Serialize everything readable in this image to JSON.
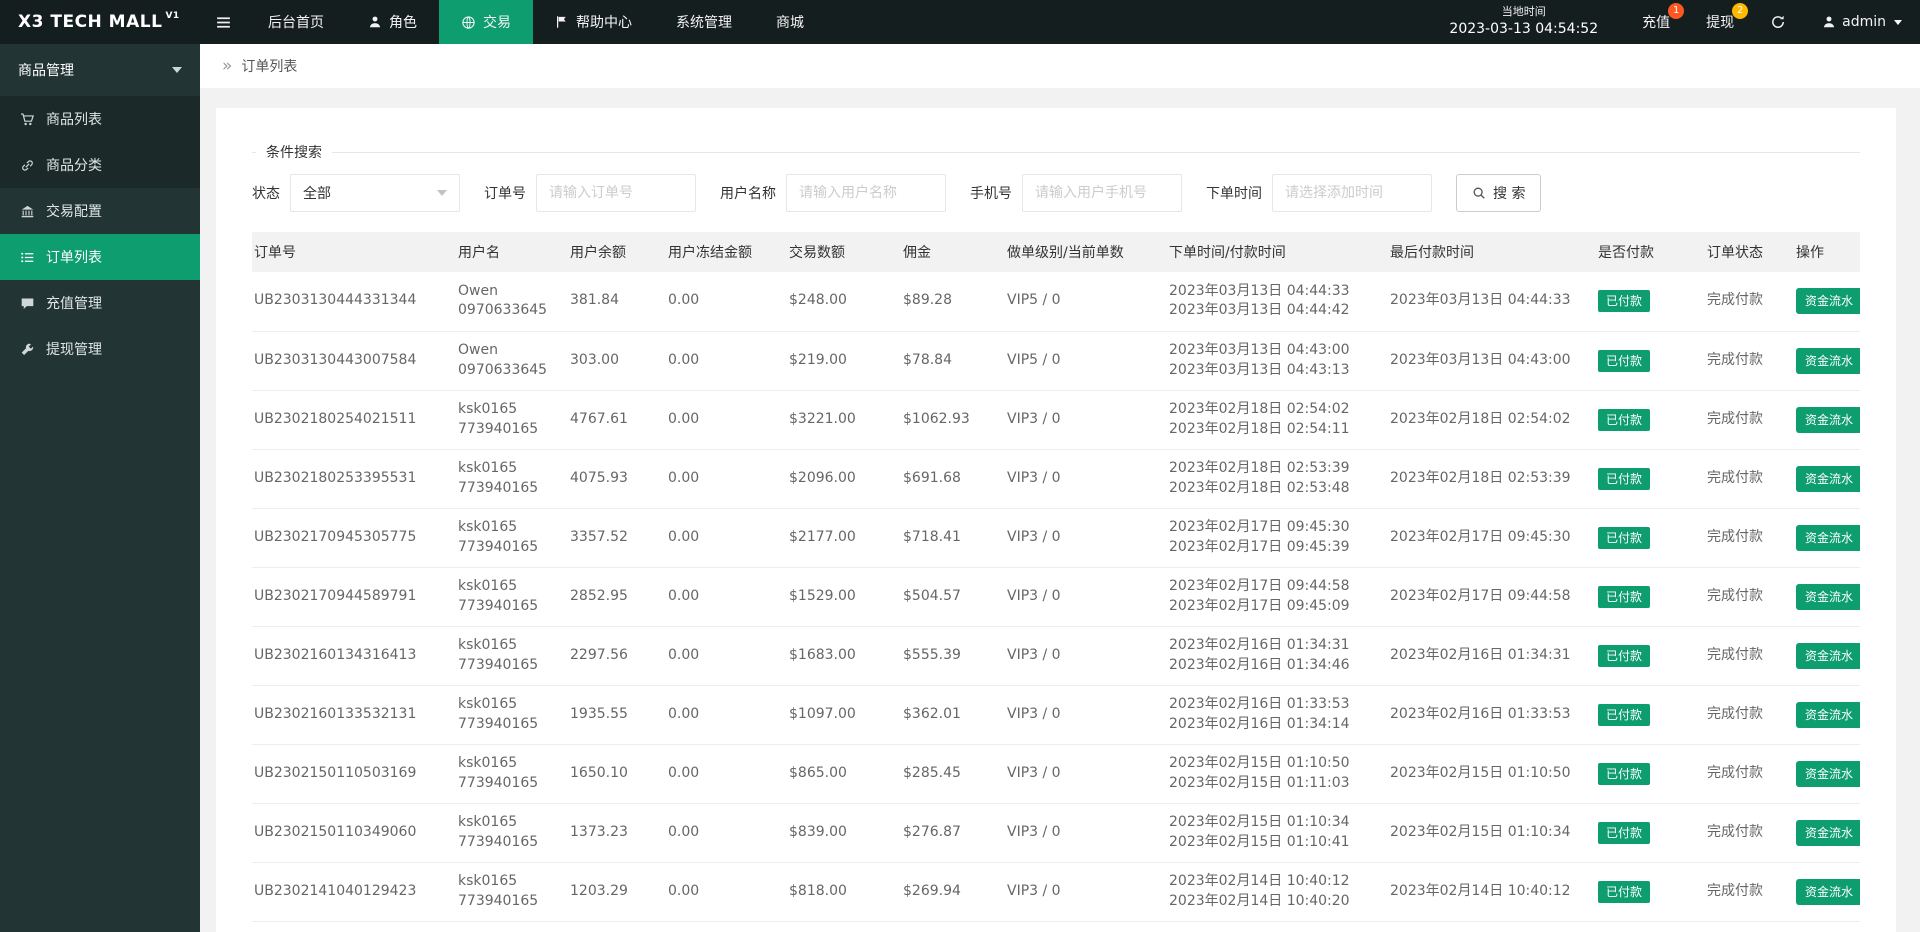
{
  "app": {
    "logo": "X3 TECH MALL",
    "logo_version": "V1"
  },
  "colors": {
    "accent_green": "#0e9d6e",
    "topbar_bg": "#151e1e",
    "sidebar_bg": "#233434",
    "badge_recharge": "#ff5722",
    "badge_withdraw": "#ffb800"
  },
  "topnav": {
    "items": [
      {
        "label": "后台首页"
      },
      {
        "label": "角色"
      },
      {
        "label": "交易"
      },
      {
        "label": "帮助中心"
      },
      {
        "label": "系统管理"
      },
      {
        "label": "商城"
      }
    ],
    "local_time_label": "当地时间",
    "local_time": "2023-03-13 04:54:52",
    "recharge_label": "充值",
    "recharge_badge": "1",
    "withdraw_label": "提现",
    "withdraw_badge": "2",
    "user_name": "admin"
  },
  "sidebar": {
    "group_label": "商品管理",
    "items": [
      {
        "label": "商品列表"
      },
      {
        "label": "商品分类"
      },
      {
        "label": "交易配置"
      },
      {
        "label": "订单列表"
      },
      {
        "label": "充值管理"
      },
      {
        "label": "提现管理"
      }
    ]
  },
  "breadcrumb": {
    "icon": "»",
    "title": "订单列表"
  },
  "search": {
    "legend": "条件搜索",
    "status_label": "状态",
    "status_value": "全部",
    "order_label": "订单号",
    "order_placeholder": "请输入订单号",
    "username_label": "用户名称",
    "username_placeholder": "请输入用户名称",
    "phone_label": "手机号",
    "phone_placeholder": "请输入用户手机号",
    "time_label": "下单时间",
    "time_placeholder": "请选择添加时间",
    "search_button": "搜 索"
  },
  "table": {
    "headers": [
      "订单号",
      "用户名",
      "用户余额",
      "用户冻结金额",
      "交易数额",
      "佣金",
      "做单级别/当前单数",
      "下单时间/付款时间",
      "最后付款时间",
      "是否付款",
      "订单状态",
      "操作"
    ],
    "rows": [
      {
        "order_no": "UB2303130444331344",
        "user_name": "Owen",
        "user_id": "0970633645",
        "balance": "381.84",
        "frozen": "0.00",
        "amount": "$248.00",
        "commission": "$89.28",
        "level": "VIP5 / 0",
        "order_time": "2023年03月13日 04:44:33",
        "pay_time": "2023年03月13日 04:44:42",
        "last_pay_time": "2023年03月13日 04:44:33",
        "paid": "已付款",
        "status": "完成付款",
        "action": "资金流水"
      },
      {
        "order_no": "UB2303130443007584",
        "user_name": "Owen",
        "user_id": "0970633645",
        "balance": "303.00",
        "frozen": "0.00",
        "amount": "$219.00",
        "commission": "$78.84",
        "level": "VIP5 / 0",
        "order_time": "2023年03月13日 04:43:00",
        "pay_time": "2023年03月13日 04:43:13",
        "last_pay_time": "2023年03月13日 04:43:00",
        "paid": "已付款",
        "status": "完成付款",
        "action": "资金流水"
      },
      {
        "order_no": "UB2302180254021511",
        "user_name": "ksk0165",
        "user_id": "773940165",
        "balance": "4767.61",
        "frozen": "0.00",
        "amount": "$3221.00",
        "commission": "$1062.93",
        "level": "VIP3 / 0",
        "order_time": "2023年02月18日 02:54:02",
        "pay_time": "2023年02月18日 02:54:11",
        "last_pay_time": "2023年02月18日 02:54:02",
        "paid": "已付款",
        "status": "完成付款",
        "action": "资金流水"
      },
      {
        "order_no": "UB2302180253395531",
        "user_name": "ksk0165",
        "user_id": "773940165",
        "balance": "4075.93",
        "frozen": "0.00",
        "amount": "$2096.00",
        "commission": "$691.68",
        "level": "VIP3 / 0",
        "order_time": "2023年02月18日 02:53:39",
        "pay_time": "2023年02月18日 02:53:48",
        "last_pay_time": "2023年02月18日 02:53:39",
        "paid": "已付款",
        "status": "完成付款",
        "action": "资金流水"
      },
      {
        "order_no": "UB2302170945305775",
        "user_name": "ksk0165",
        "user_id": "773940165",
        "balance": "3357.52",
        "frozen": "0.00",
        "amount": "$2177.00",
        "commission": "$718.41",
        "level": "VIP3 / 0",
        "order_time": "2023年02月17日 09:45:30",
        "pay_time": "2023年02月17日 09:45:39",
        "last_pay_time": "2023年02月17日 09:45:30",
        "paid": "已付款",
        "status": "完成付款",
        "action": "资金流水"
      },
      {
        "order_no": "UB2302170944589791",
        "user_name": "ksk0165",
        "user_id": "773940165",
        "balance": "2852.95",
        "frozen": "0.00",
        "amount": "$1529.00",
        "commission": "$504.57",
        "level": "VIP3 / 0",
        "order_time": "2023年02月17日 09:44:58",
        "pay_time": "2023年02月17日 09:45:09",
        "last_pay_time": "2023年02月17日 09:44:58",
        "paid": "已付款",
        "status": "完成付款",
        "action": "资金流水"
      },
      {
        "order_no": "UB2302160134316413",
        "user_name": "ksk0165",
        "user_id": "773940165",
        "balance": "2297.56",
        "frozen": "0.00",
        "amount": "$1683.00",
        "commission": "$555.39",
        "level": "VIP3 / 0",
        "order_time": "2023年02月16日 01:34:31",
        "pay_time": "2023年02月16日 01:34:46",
        "last_pay_time": "2023年02月16日 01:34:31",
        "paid": "已付款",
        "status": "完成付款",
        "action": "资金流水"
      },
      {
        "order_no": "UB2302160133532131",
        "user_name": "ksk0165",
        "user_id": "773940165",
        "balance": "1935.55",
        "frozen": "0.00",
        "amount": "$1097.00",
        "commission": "$362.01",
        "level": "VIP3 / 0",
        "order_time": "2023年02月16日 01:33:53",
        "pay_time": "2023年02月16日 01:34:14",
        "last_pay_time": "2023年02月16日 01:33:53",
        "paid": "已付款",
        "status": "完成付款",
        "action": "资金流水"
      },
      {
        "order_no": "UB2302150110503169",
        "user_name": "ksk0165",
        "user_id": "773940165",
        "balance": "1650.10",
        "frozen": "0.00",
        "amount": "$865.00",
        "commission": "$285.45",
        "level": "VIP3 / 0",
        "order_time": "2023年02月15日 01:10:50",
        "pay_time": "2023年02月15日 01:11:03",
        "last_pay_time": "2023年02月15日 01:10:50",
        "paid": "已付款",
        "status": "完成付款",
        "action": "资金流水"
      },
      {
        "order_no": "UB2302150110349060",
        "user_name": "ksk0165",
        "user_id": "773940165",
        "balance": "1373.23",
        "frozen": "0.00",
        "amount": "$839.00",
        "commission": "$276.87",
        "level": "VIP3 / 0",
        "order_time": "2023年02月15日 01:10:34",
        "pay_time": "2023年02月15日 01:10:41",
        "last_pay_time": "2023年02月15日 01:10:34",
        "paid": "已付款",
        "status": "完成付款",
        "action": "资金流水"
      },
      {
        "order_no": "UB2302141040129423",
        "user_name": "ksk0165",
        "user_id": "773940165",
        "balance": "1203.29",
        "frozen": "0.00",
        "amount": "$818.00",
        "commission": "$269.94",
        "level": "VIP3 / 0",
        "order_time": "2023年02月14日 10:40:12",
        "pay_time": "2023年02月14日 10:40:20",
        "last_pay_time": "2023年02月14日 10:40:12",
        "paid": "已付款",
        "status": "完成付款",
        "action": "资金流水"
      }
    ]
  }
}
